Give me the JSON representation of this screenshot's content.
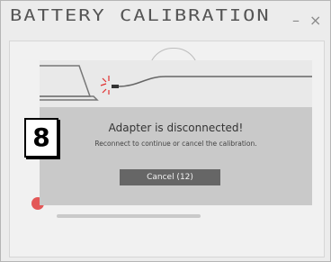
{
  "window": {
    "title": "BATTERY CALIBRATION",
    "minimize_label": "–",
    "close_label": "×"
  },
  "dialog": {
    "title": "Adapter is disconnected!",
    "message": "Reconnect to continue or cancel the calibration.",
    "cancel_label": "Cancel (12)",
    "countdown_seconds": 12
  },
  "step_badge": "8",
  "colors": {
    "overlay": "#c9c9c9",
    "button": "#666666",
    "spark": "#e03030",
    "alert_badge": "#e35757"
  },
  "icons": [
    "laptop-icon",
    "plug-disconnect-icon"
  ]
}
